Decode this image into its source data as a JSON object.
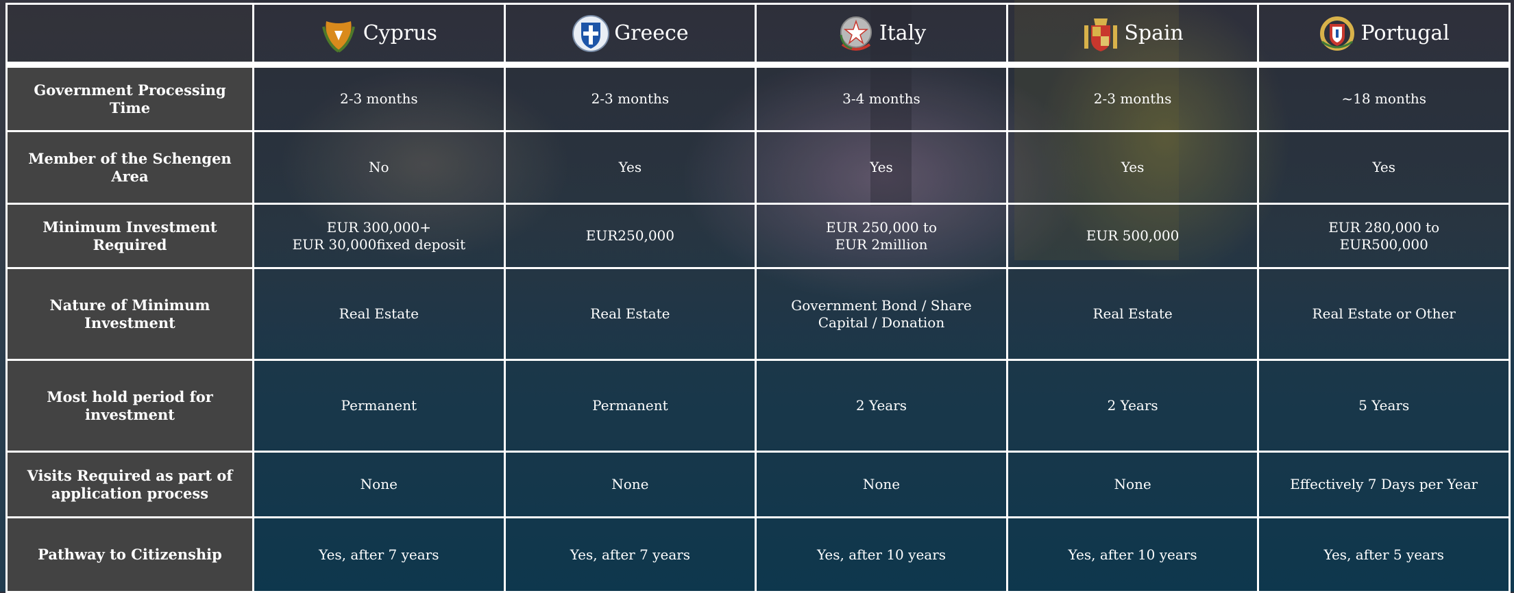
{
  "countries": [
    {
      "name": "Cyprus",
      "icon": "cyprus-emblem-icon"
    },
    {
      "name": "Greece",
      "icon": "greece-emblem-icon"
    },
    {
      "name": "Italy",
      "icon": "italy-emblem-icon"
    },
    {
      "name": "Spain",
      "icon": "spain-emblem-icon"
    },
    {
      "name": "Portugal",
      "icon": "portugal-emblem-icon"
    }
  ],
  "rows": [
    {
      "label": "Government Processing Time",
      "values": [
        "2-3 months",
        "2-3 months",
        "3-4 months",
        "2-3 months",
        "~18 months"
      ]
    },
    {
      "label": "Member of the Schengen Area",
      "values": [
        "No",
        "Yes",
        "Yes",
        "Yes",
        "Yes"
      ]
    },
    {
      "label": "Minimum Investment Required",
      "values": [
        [
          "EUR 300,000+",
          "EUR 30,000fixed deposit"
        ],
        [
          "EUR250,000"
        ],
        [
          "EUR 250,000 to",
          "EUR 2million"
        ],
        [
          "EUR 500,000"
        ],
        [
          "EUR 280,000 to",
          "EUR500,000"
        ]
      ]
    },
    {
      "label": "Nature of Minimum Investment",
      "values": [
        "Real Estate",
        "Real Estate",
        "Government Bond / Share Capital / Donation",
        "Real Estate",
        "Real Estate or Other"
      ]
    },
    {
      "label": "Most hold period for investment",
      "values": [
        "Permanent",
        "Permanent",
        "2 Years",
        "2 Years",
        "5 Years"
      ]
    },
    {
      "label": "Visits Required as part of application process",
      "values": [
        "None",
        "None",
        "None",
        "None",
        "Effectively  7 Days per Year"
      ]
    },
    {
      "label": "Pathway to Citizenship",
      "values": [
        "Yes, after 7 years",
        "Yes, after 7 years",
        "Yes, after 10 years",
        "Yes, after 10 years",
        "Yes, after 5 years"
      ]
    }
  ]
}
